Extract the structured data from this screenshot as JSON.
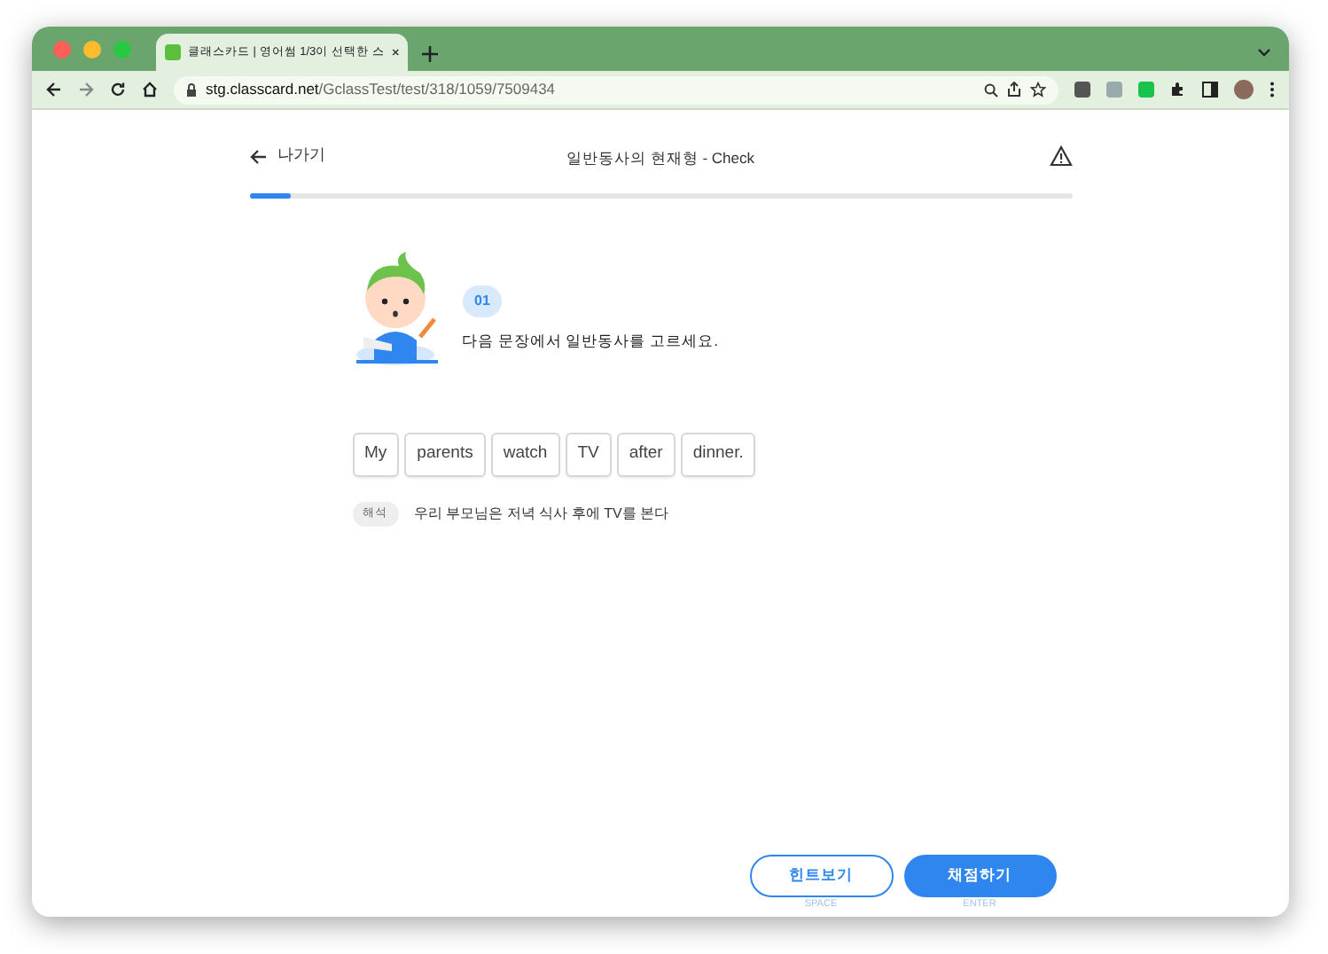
{
  "browser": {
    "tab_title": "클래스카드 | 영어썸 1/3이 선택한 스",
    "url_host": "stg.classcard.net",
    "url_path": "/GclassTest/test/318/1059/7509434"
  },
  "header": {
    "back_label": "나가기",
    "title": "일반동사의 현재형 - Check"
  },
  "progress": {
    "level": 0.05
  },
  "question": {
    "number": "01",
    "instruction": "다음 문장에서 일반동사를 고르세요.",
    "words": [
      {
        "text": "My",
        "selected": false
      },
      {
        "text": "parents",
        "selected": false
      },
      {
        "text": "watch",
        "selected": false
      },
      {
        "text": "TV",
        "selected": false
      },
      {
        "text": "after",
        "selected": false
      },
      {
        "text": "dinner.",
        "selected": false
      }
    ],
    "translation_tag": "해석",
    "translation": "우리 부모님은 저녁 식사 후에 TV를 본다"
  },
  "buttons": [
    {
      "kind": "outline",
      "label": "힌트보기",
      "key_hint": "SPACE"
    },
    {
      "kind": "filled",
      "label": "채점하기",
      "key_hint": "ENTER"
    }
  ]
}
